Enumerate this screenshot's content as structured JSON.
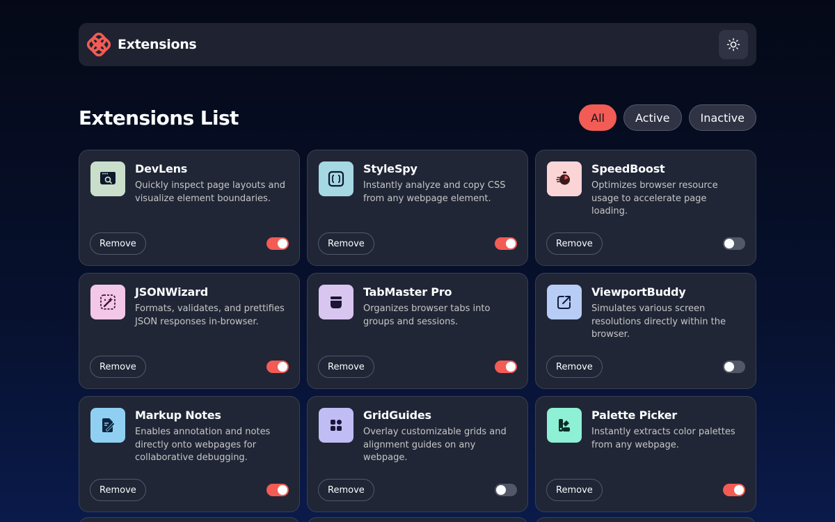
{
  "header": {
    "brand_name": "Extensions",
    "logo_icon": "flower-logo-icon",
    "theme_toggle_icon": "sun-icon"
  },
  "list": {
    "title": "Extensions List",
    "filters": [
      {
        "label": "All",
        "active": true
      },
      {
        "label": "Active",
        "active": false
      },
      {
        "label": "Inactive",
        "active": false
      }
    ]
  },
  "remove_label": "Remove",
  "colors": {
    "accent": "#f25c54",
    "card_bg": "#212636",
    "toggle_off": "#525868"
  },
  "extensions": [
    {
      "name": "DevLens",
      "description": "Quickly inspect page layouts and visualize element boundaries.",
      "enabled": true,
      "icon": "devlens-icon",
      "icon_bg": "#c9dfcc"
    },
    {
      "name": "StyleSpy",
      "description": "Instantly analyze and copy CSS from any webpage element.",
      "enabled": true,
      "icon": "stylespy-icon",
      "icon_bg": "#a5d8e3"
    },
    {
      "name": "SpeedBoost",
      "description": "Optimizes browser resource usage to accelerate page loading.",
      "enabled": false,
      "icon": "speedboost-icon",
      "icon_bg": "#fbd5d6"
    },
    {
      "name": "JSONWizard",
      "description": "Formats, validates, and prettifies JSON responses in-browser.",
      "enabled": true,
      "icon": "jsonwizard-icon",
      "icon_bg": "#f3c7e8"
    },
    {
      "name": "TabMaster Pro",
      "description": "Organizes browser tabs into groups and sessions.",
      "enabled": true,
      "icon": "tabmaster-icon",
      "icon_bg": "#d9c6f0"
    },
    {
      "name": "ViewportBuddy",
      "description": "Simulates various screen resolutions directly within the browser.",
      "enabled": false,
      "icon": "viewportbuddy-icon",
      "icon_bg": "#b8cdf5"
    },
    {
      "name": "Markup Notes",
      "description": "Enables annotation and notes directly onto webpages for collaborative debugging.",
      "enabled": true,
      "icon": "markup-notes-icon",
      "icon_bg": "#8fd0f2"
    },
    {
      "name": "GridGuides",
      "description": "Overlay customizable grids and alignment guides on any webpage.",
      "enabled": false,
      "icon": "gridguides-icon",
      "icon_bg": "#c0bdf5"
    },
    {
      "name": "Palette Picker",
      "description": "Instantly extracts color palettes from any webpage.",
      "enabled": true,
      "icon": "palette-picker-icon",
      "icon_bg": "#8ef0d4"
    }
  ]
}
